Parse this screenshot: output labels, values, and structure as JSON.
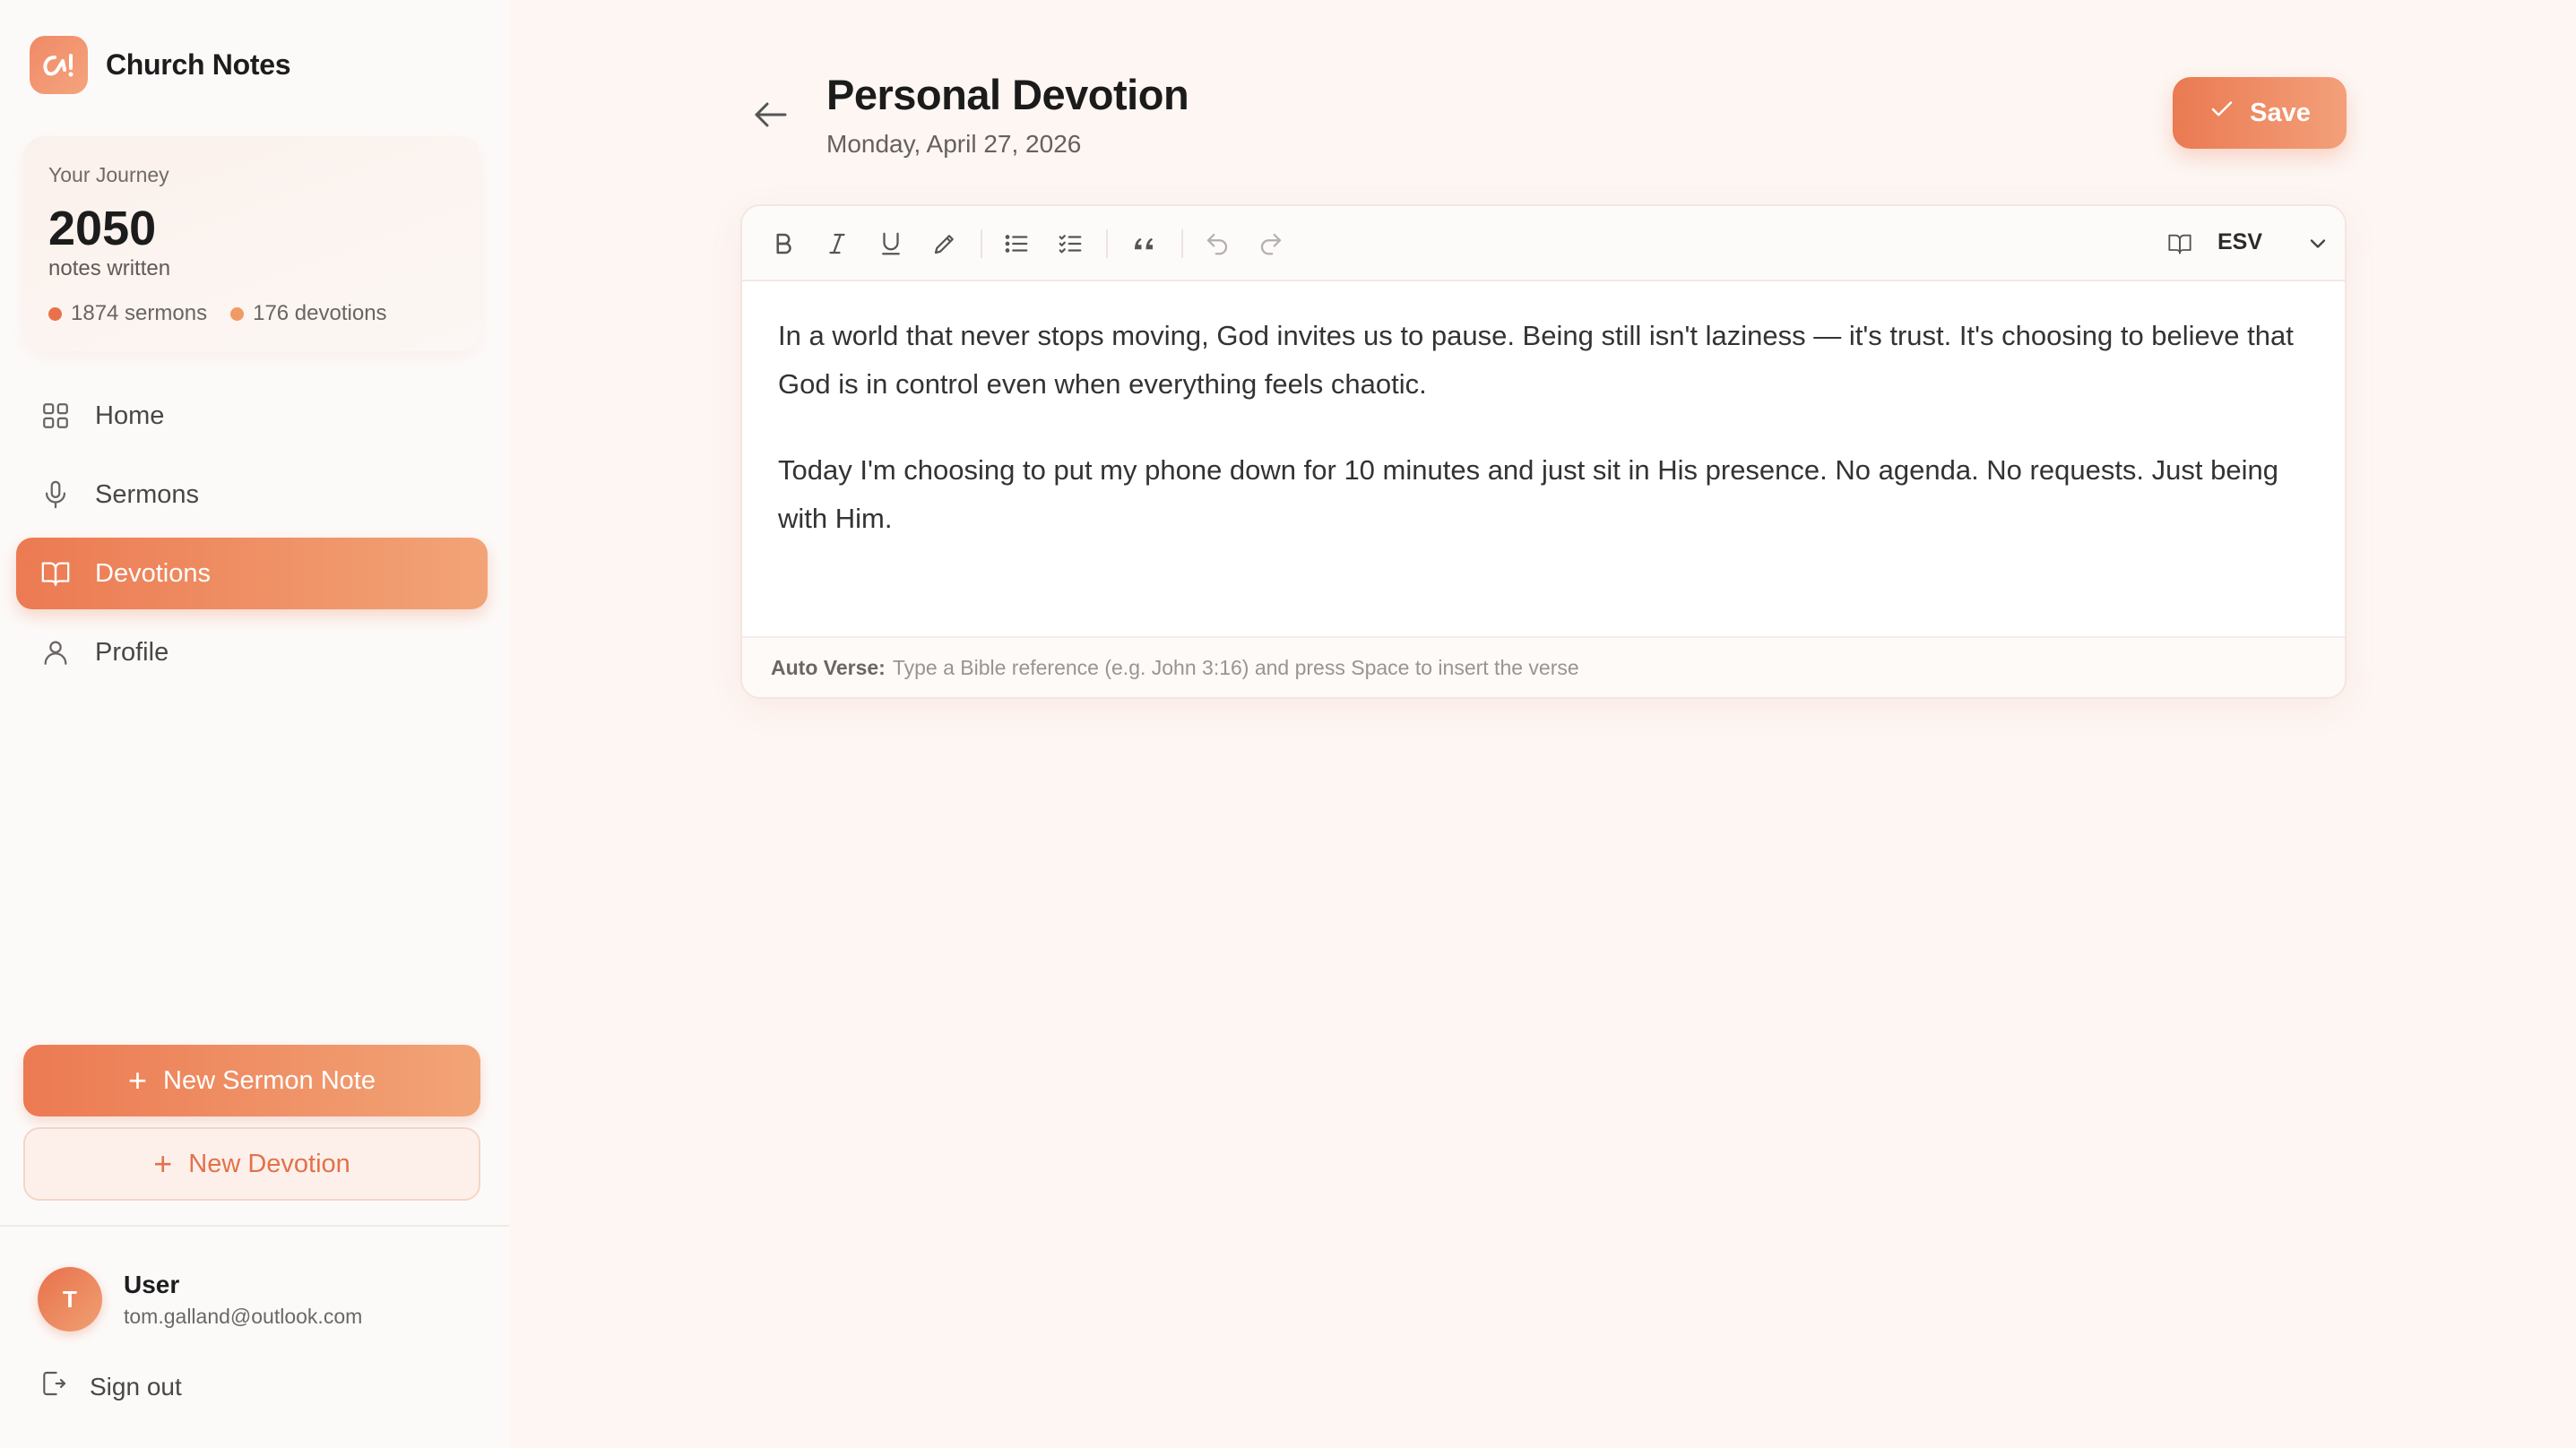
{
  "app": {
    "name": "Church Notes"
  },
  "journey": {
    "label": "Your Journey",
    "count": "2050",
    "sub": "notes written",
    "sermons": "1874 sermons",
    "devotions": "176 devotions"
  },
  "nav": {
    "items": [
      {
        "label": "Home",
        "icon": "grid-icon"
      },
      {
        "label": "Sermons",
        "icon": "microphone-icon"
      },
      {
        "label": "Devotions",
        "icon": "book-icon",
        "active": true
      },
      {
        "label": "Profile",
        "icon": "user-icon"
      }
    ]
  },
  "actions": {
    "new_sermon": "New Sermon Note",
    "new_devotion": "New Devotion"
  },
  "user": {
    "name": "User",
    "initial": "T",
    "email": "tom.galland@outlook.com",
    "signout": "Sign out"
  },
  "page": {
    "title": "Personal Devotion",
    "date": "Monday, April 27, 2026",
    "save": "Save"
  },
  "editor": {
    "translation": "ESV",
    "paragraphs": [
      "In a world that never stops moving, God invites us to pause. Being still isn't laziness — it's trust. It's choosing to believe that God is in control even when everything feels chaotic.",
      "Today I'm choosing to put my phone down for 10 minutes and just sit in His presence. No agenda. No requests. Just being with Him."
    ],
    "hint_label": "Auto Verse:",
    "hint_text": "Type a Bible reference (e.g. John 3:16) and press Space to insert the verse"
  },
  "colors": {
    "accent": "#ec7a52",
    "accent_light": "#f2a477",
    "background": "#fdf6f3"
  }
}
